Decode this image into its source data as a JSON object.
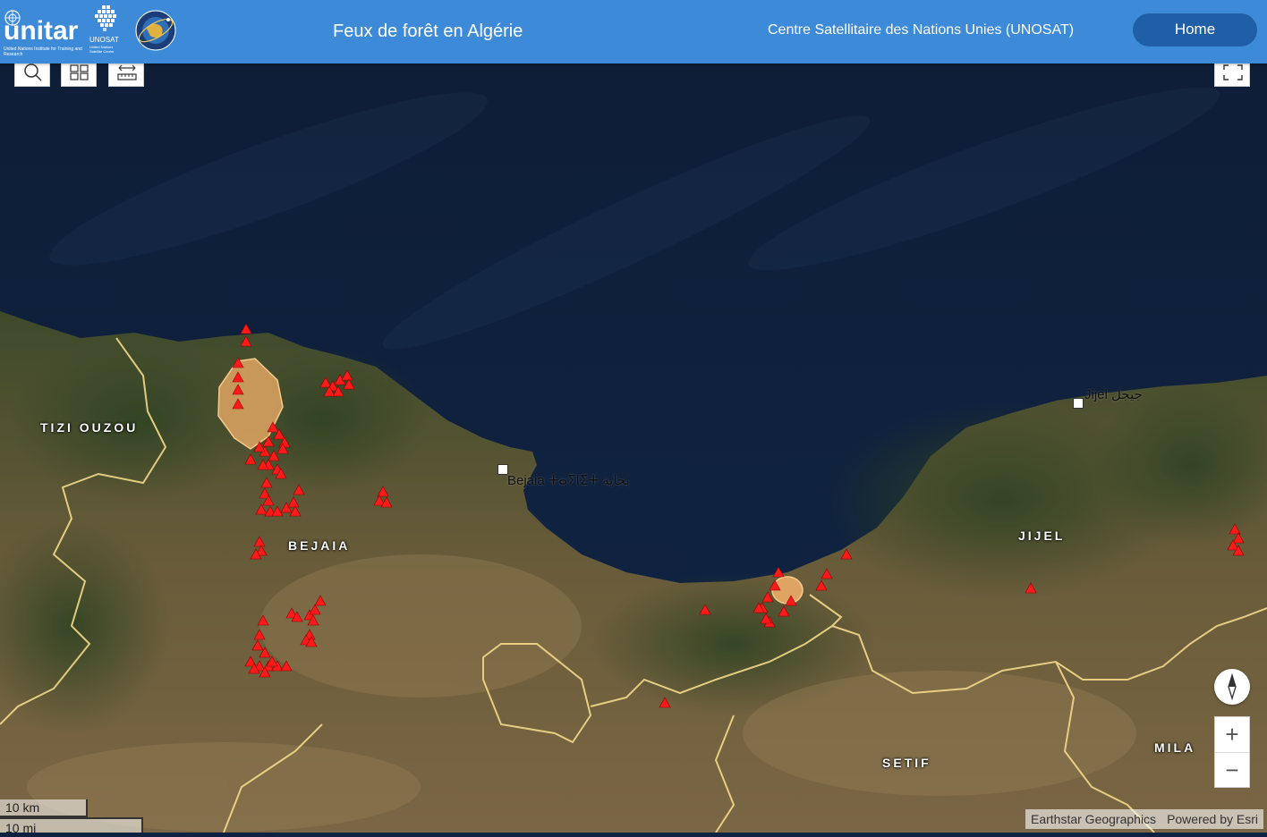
{
  "header": {
    "unitar_word": "unitar",
    "unitar_sub": "United Nations Institute for Training and Research",
    "unosat_word": "UNOSAT",
    "unosat_sub": "United Nations Satellite Centre",
    "title": "Feux de forêt en Algérie",
    "center_name": "Centre Satellitaire des Nations Unies (UNOSAT)",
    "home_label": "Home",
    "accent": "#3d8ad8",
    "button_color": "#1f5fa8"
  },
  "toolbar": {
    "search_icon": "search-icon",
    "basemap_icon": "basemap-gallery-icon",
    "measure_icon": "measure-icon",
    "fullscreen_icon": "fullscreen-icon"
  },
  "map": {
    "region_labels": [
      "TIZI OUZOU",
      "BEJAIA",
      "JIJEL",
      "SETIF",
      "MILA"
    ],
    "city_labels": [
      "Bejaia ⵜⴰⵢⵏⵉⵜ بجاية",
      "Jijel جيجل"
    ],
    "fire_color": "#ff1a1a",
    "burn_area_color": "#f4b26b",
    "border_color": "#f3d98a"
  },
  "zoom": {
    "in_label": "+",
    "out_label": "−"
  },
  "scale": {
    "km_label": "10 km",
    "mi_label": "10 mi"
  },
  "attribution": {
    "source": "Earthstar Geographics",
    "powered": "Powered by Esri"
  }
}
